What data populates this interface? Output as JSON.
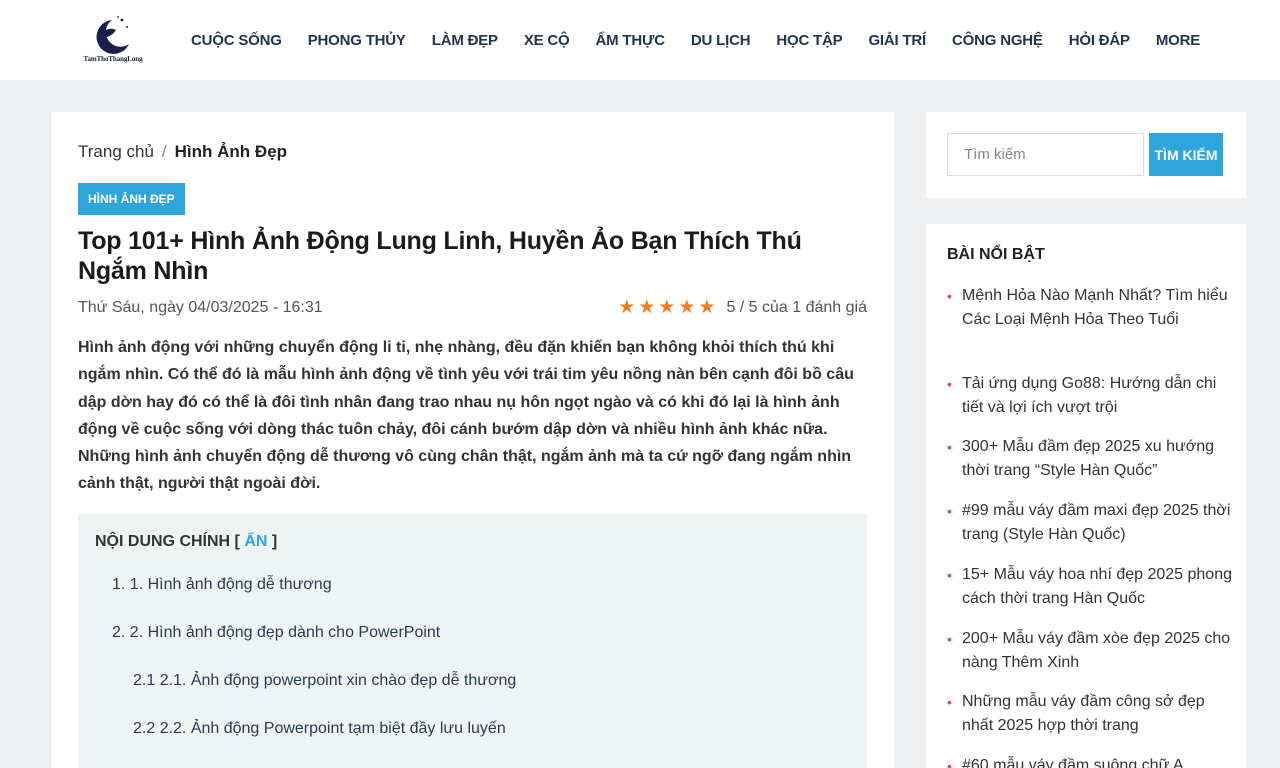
{
  "header": {
    "logo_text": "TamThoThangLong",
    "nav": [
      "CUỘC SỐNG",
      "PHONG THỦY",
      "LÀM ĐẸP",
      "XE CỘ",
      "ẨM THỰC",
      "DU LỊCH",
      "HỌC TẬP",
      "GIẢI TRÍ",
      "CÔNG NGHỆ",
      "HỎI ĐÁP",
      "MORE"
    ]
  },
  "breadcrumb": {
    "home": "Trang chủ",
    "separator": "/",
    "current": "Hình Ảnh Đẹp"
  },
  "article": {
    "category": "HÌNH ẢNH ĐẸP",
    "title": "Top 101+ Hình Ảnh Động Lung Linh, Huyền Ảo Bạn Thích Thú Ngắm Nhìn",
    "date": "Thứ Sáu, ngày 04/03/2025 - 16:31",
    "rating_stars": 5,
    "rating_text": "5 / 5 của 1 đánh giá",
    "lead": "Hình ảnh động với những chuyển động li ti, nhẹ nhàng, đều đặn khiến bạn không khỏi thích thú khi ngắm nhìn. Có thể đó là mẫu hình ảnh động về tình yêu với trái tim yêu nồng nàn bên cạnh đôi bồ câu dập dờn hay đó có thể là đôi tình nhân đang trao nhau nụ hôn ngọt ngào và có khi đó lại là hình ảnh động về cuộc sống với dòng thác tuôn chảy, đôi cánh bướm dập dờn và nhiều hình ảnh khác nữa. Những hình ảnh chuyển động dễ thương vô cùng chân thật, ngắm ảnh mà ta cứ ngỡ đang ngắm nhìn cảnh thật, người thật ngoài đời."
  },
  "toc": {
    "title": "NỘI DUNG CHÍNH",
    "toggle": "ẨN",
    "items": [
      "1. 1. Hình ảnh động dễ thương",
      "2. 2. Hình ảnh động đẹp dành cho PowerPoint",
      "2.1 2.1. Ảnh động powerpoint xin chào đẹp dễ thương",
      "2.2 2.2. Ảnh động Powerpoint tạm biệt đầy lưu luyến"
    ]
  },
  "sidebar": {
    "search_placeholder": "Tìm kiếm",
    "search_button": "TÌM KIẾM",
    "featured_title": "BÀI NỔI BẬT",
    "featured": [
      "Mệnh Hỏa Nào Mạnh Nhất? Tìm hiểu Các Loại Mệnh Hỏa Theo Tuổi",
      "Tải ứng dụng Go88: Hướng dẫn chi tiết và lợi ích vượt trội",
      "300+ Mẫu đầm đẹp 2025 xu hướng thời trang “Style Hàn Quốc”",
      "#99 mẫu váy đầm maxi đẹp 2025 thời trang (Style Hàn Quốc)",
      "15+ Mẫu váy hoa nhí đẹp 2025 phong cách thời trang Hàn Quốc",
      "200+ Mẫu váy đầm xòe đẹp 2025 cho nàng Thêm Xinh",
      "Những mẫu váy đầm công sở đẹp nhất 2025 hợp thời trang",
      "#60 mẫu váy đầm suông chữ A"
    ]
  }
}
